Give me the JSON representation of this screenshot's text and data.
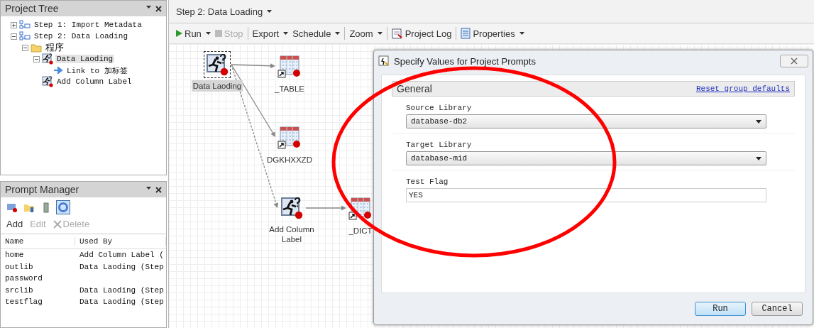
{
  "project_tree": {
    "title": "Project Tree",
    "items": [
      {
        "label": "Step 1: Import Metadata",
        "kind": "step",
        "expanded": false,
        "selected": false
      },
      {
        "label": "Step 2: Data Loading",
        "kind": "step",
        "expanded": true,
        "selected": false,
        "children": [
          {
            "label": "程序",
            "kind": "folder",
            "expanded": true,
            "selected": false,
            "children": [
              {
                "label": "Data Laoding",
                "kind": "job",
                "expanded": true,
                "selected": true,
                "children": [
                  {
                    "label": "Link to 加标签",
                    "kind": "link",
                    "selected": false
                  }
                ]
              },
              {
                "label": "Add Column Label",
                "kind": "job",
                "selected": false
              }
            ]
          }
        ]
      }
    ]
  },
  "prompt_manager": {
    "title": "Prompt Manager",
    "view_buttons": [
      {
        "selected": false
      },
      {
        "selected": false
      },
      {
        "selected": false
      },
      {
        "selected": true
      }
    ],
    "actions": [
      {
        "label": "Add",
        "disabled": false
      },
      {
        "label": "Edit",
        "disabled": true
      },
      {
        "label": "Delete",
        "disabled": true
      }
    ],
    "columns": [
      "Name",
      "Used By"
    ],
    "rows": [
      [
        "home",
        "Add Column Label ("
      ],
      [
        "outlib",
        "Data Laoding (Step"
      ],
      [
        "password",
        ""
      ],
      [
        "srclib",
        "Data Laoding (Step"
      ],
      [
        "testflag",
        "Data Laoding (Step"
      ]
    ]
  },
  "flow": {
    "title": "Step 2: Data Loading",
    "toolbar": [
      {
        "label": "Run",
        "kind": "run",
        "menu": true,
        "disabled": false
      },
      {
        "label": "Stop",
        "kind": "stop",
        "menu": false,
        "disabled": true
      },
      {
        "kind": "separator"
      },
      {
        "label": "Export",
        "kind": "text",
        "menu": true,
        "disabled": false
      },
      {
        "label": "Schedule",
        "kind": "text",
        "menu": true,
        "disabled": false
      },
      {
        "kind": "separator"
      },
      {
        "label": "Zoom",
        "kind": "text",
        "menu": true,
        "disabled": false
      },
      {
        "kind": "separator"
      },
      {
        "label": "Project Log",
        "kind": "log",
        "menu": false,
        "disabled": false
      },
      {
        "kind": "separator"
      },
      {
        "label": "Properties",
        "kind": "properties",
        "menu": true,
        "disabled": false
      }
    ],
    "nodes": [
      {
        "label": "Data Laoding",
        "kind": "job",
        "selected": true
      },
      {
        "label": "_TABLE",
        "kind": "table",
        "selected": false
      },
      {
        "label": "DGKHXXZD",
        "kind": "table",
        "selected": false
      },
      {
        "label": "Add Column Label",
        "kind": "job",
        "selected": false
      },
      {
        "label": "_DICT",
        "kind": "table",
        "selected": false
      }
    ],
    "edges": [
      {
        "dashed": false
      },
      {
        "dashed": false
      },
      {
        "dashed": true
      },
      {
        "dashed": false
      }
    ]
  },
  "dialog": {
    "title": "Specify Values for Project Prompts",
    "group": "General",
    "reset_link": "Reset group defaults",
    "fields": [
      {
        "label": "Source Library",
        "kind": "select",
        "value": "database-db2"
      },
      {
        "label": "Target Library",
        "kind": "select",
        "value": "database-mid"
      },
      {
        "label": "Test Flag",
        "kind": "text",
        "value": "YES"
      }
    ],
    "buttons": [
      {
        "label": "Run",
        "default": true
      },
      {
        "label": "Cancel",
        "default": false
      }
    ]
  }
}
